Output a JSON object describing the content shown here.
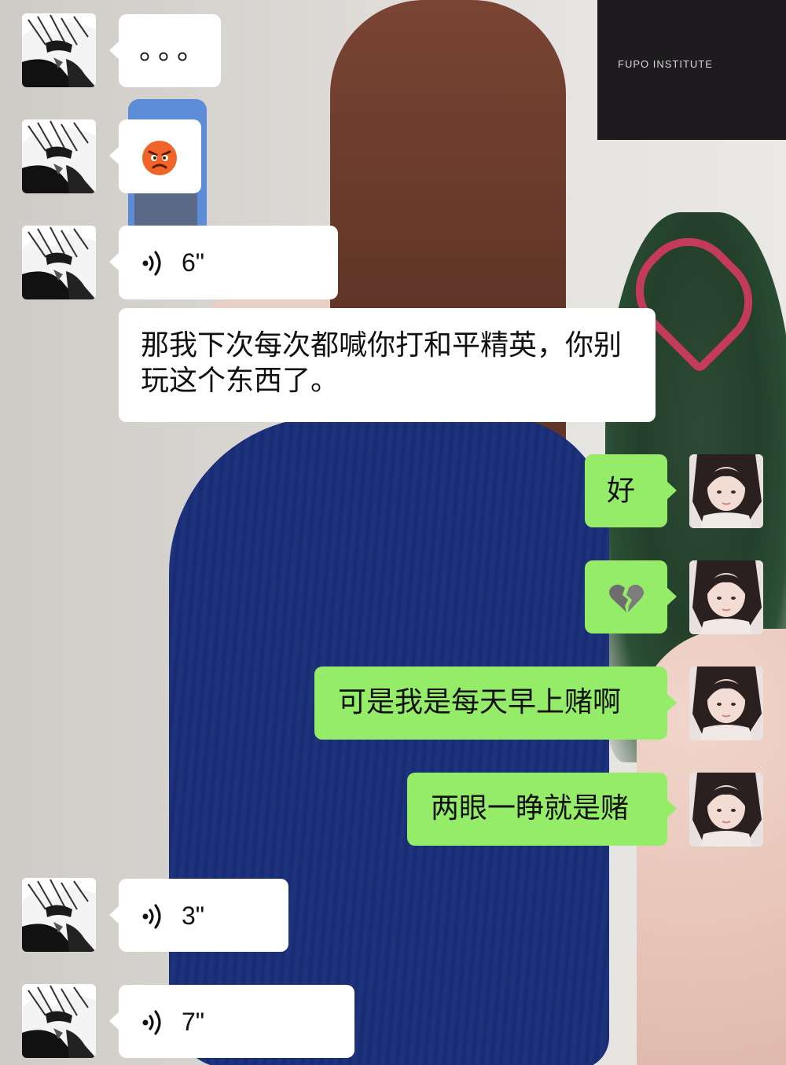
{
  "background": {
    "sign_text": "FUPO INSTITUTE"
  },
  "messages": [
    {
      "id": "m1",
      "side": "left",
      "type": "text",
      "text": "。。。"
    },
    {
      "id": "m2",
      "side": "left",
      "type": "emoji",
      "emoji": "😡",
      "icon": "angry-face-icon"
    },
    {
      "id": "m3",
      "side": "left",
      "type": "voice",
      "duration": "6\""
    },
    {
      "id": "m4",
      "side": "left",
      "type": "text",
      "text": "那我下次每次都喊你打和平精英，你别玩这个东西了。"
    },
    {
      "id": "m5",
      "side": "right",
      "type": "text",
      "text": "好"
    },
    {
      "id": "m6",
      "side": "right",
      "type": "emoji",
      "emoji": "💔",
      "icon": "broken-heart-icon"
    },
    {
      "id": "m7",
      "side": "right",
      "type": "text",
      "text": "可是我是每天早上赌啊"
    },
    {
      "id": "m8",
      "side": "right",
      "type": "text",
      "text": "两眼一睁就是赌"
    },
    {
      "id": "m9",
      "side": "left",
      "type": "voice",
      "duration": "3\""
    },
    {
      "id": "m10",
      "side": "left",
      "type": "voice",
      "duration": "7\""
    }
  ],
  "colors": {
    "incoming_bubble": "#ffffff",
    "outgoing_bubble": "#95ec69",
    "text": "#111111"
  }
}
